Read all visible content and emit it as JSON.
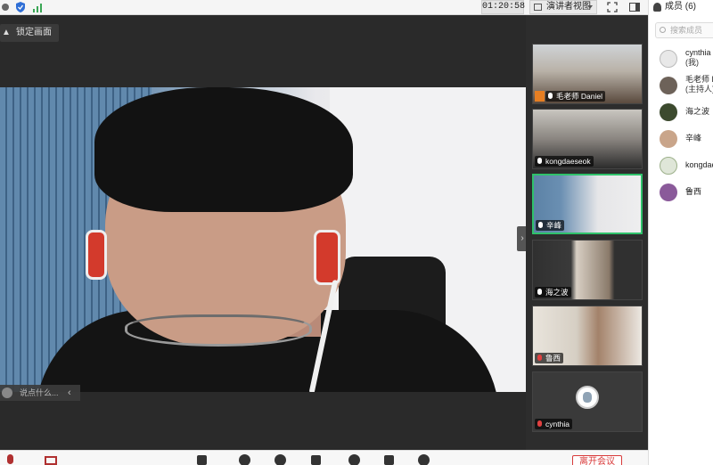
{
  "topbar": {
    "timer": "01:20:58",
    "view_label": "演讲者视图"
  },
  "stage": {
    "pin_label": "锁定画面",
    "chat_placeholder": "说点什么...",
    "collapse_symbol": "‹",
    "side_toggle_symbol": "›"
  },
  "thumbnails": [
    {
      "name": "毛老师 Daniel",
      "host": true,
      "active": false
    },
    {
      "name": "kongdaeseok",
      "host": false,
      "active": false
    },
    {
      "name": "辛峰",
      "host": false,
      "active": true
    },
    {
      "name": "海之波",
      "host": false,
      "active": false
    },
    {
      "name": "鲁西",
      "host": false,
      "active": false
    },
    {
      "name": "cynthia",
      "host": false,
      "active": false
    }
  ],
  "members": {
    "title": "成员 (6)",
    "search_placeholder": "搜索成员",
    "list": [
      {
        "name": "cynthia",
        "sub": "(我)"
      },
      {
        "name": "毛老师 D",
        "sub": "(主持人)"
      },
      {
        "name": "海之波",
        "sub": ""
      },
      {
        "name": "辛峰",
        "sub": ""
      },
      {
        "name": "kongdae",
        "sub": ""
      },
      {
        "name": "鲁西",
        "sub": ""
      }
    ]
  },
  "toolbar": {
    "leave_label": "离开会议"
  },
  "colors": {
    "active_border": "#2fc26b",
    "danger": "#d83a3a"
  }
}
